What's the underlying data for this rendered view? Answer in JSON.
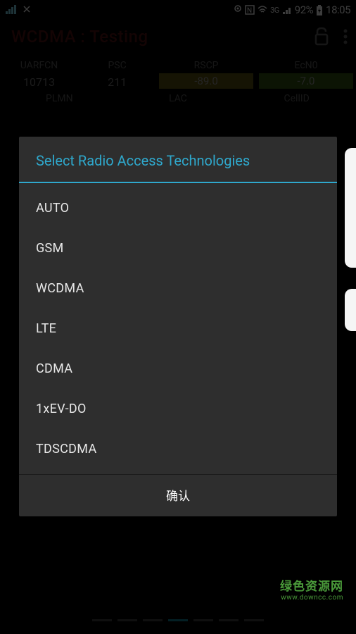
{
  "status_bar": {
    "battery_percent": "92%",
    "time": "18:05",
    "network_type": "3G"
  },
  "header": {
    "title": "WCDMA : Testing"
  },
  "grid": {
    "row1_labels": [
      "UARFCN",
      "PSC",
      "RSCP",
      "EcN0"
    ],
    "row1_values": [
      "10713",
      "211",
      "-89.0",
      "-7.0"
    ],
    "row2_labels": [
      "PLMN",
      "LAC",
      "CellID"
    ]
  },
  "dialog": {
    "title": "Select Radio Access Technologies",
    "items": [
      "AUTO",
      "GSM",
      "WCDMA",
      "LTE",
      "CDMA",
      "1xEV-DO",
      "TDSCDMA"
    ],
    "confirm": "确认"
  },
  "watermark": {
    "main": "绿色资源网",
    "sub": "www.downcc.com"
  }
}
